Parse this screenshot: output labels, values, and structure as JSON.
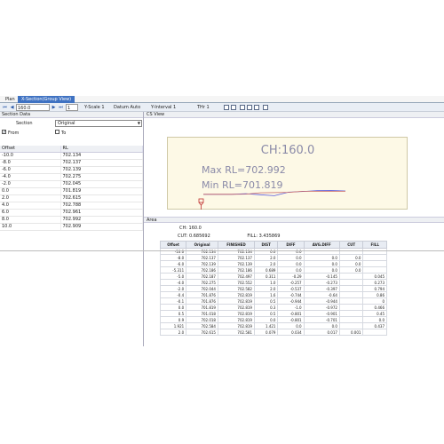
{
  "tabs": [
    {
      "label": "Plan"
    },
    {
      "label": "X-Section(Group View)"
    }
  ],
  "toolbar": {
    "ch_value": "160.0",
    "page_value": "1",
    "yscale_label": "Y-Scale",
    "yscale_value": "1",
    "datum_label": "Datum",
    "datum_value": "Auto",
    "yinterval_label": "Y-Interval",
    "yinterval_value": "1",
    "thr_label": "THr",
    "thr_value": "1"
  },
  "section_data": {
    "title": "Section Data",
    "section_label": "Section",
    "section_value": "Original",
    "from_label": "From",
    "to_label": "To",
    "columns": [
      "Offset",
      "RL"
    ],
    "rows": [
      [
        "-10.0",
        "702.134"
      ],
      [
        "-8.0",
        "702.137"
      ],
      [
        "-6.0",
        "702.139"
      ],
      [
        "-4.0",
        "702.275"
      ],
      [
        "-2.0",
        "702.045"
      ],
      [
        "0.0",
        "701.819"
      ],
      [
        "2.0",
        "702.615"
      ],
      [
        "4.0",
        "702.788"
      ],
      [
        "6.0",
        "702.961"
      ],
      [
        "8.0",
        "702.992"
      ],
      [
        "10.0",
        "702.909"
      ]
    ]
  },
  "cs_view": {
    "title": "CS View",
    "ch_text": "CH:160.0",
    "max_text": "Max RL=702.992",
    "min_text": "Min  RL=701.819"
  },
  "chart_data": {
    "type": "line",
    "title": "CH:160.0",
    "xlabel": "",
    "ylabel": "",
    "x": [
      -10.0,
      -8.0,
      -6.0,
      -4.0,
      -2.0,
      0.0,
      2.0,
      4.0,
      6.0,
      8.0,
      10.0
    ],
    "series": [
      {
        "values": [
          702.134,
          702.137,
          702.139,
          702.275,
          702.045,
          701.819,
          702.615,
          702.788,
          702.961,
          702.992,
          702.909
        ],
        "color": "#5a5adc"
      },
      {
        "values": [
          702.134,
          702.137,
          702.139,
          702.186,
          702.479,
          702.521,
          702.582,
          702.819,
          702.819,
          702.819,
          702.819
        ],
        "color": "#c86464"
      }
    ],
    "colors": {
      "profile": "#5a5adc",
      "design": "#c86464",
      "background": "#fdf9e6"
    }
  },
  "area": {
    "title": "Area",
    "ch_label": "CH:",
    "ch_value": "160.0",
    "cut_label": "CUT:",
    "cut_value": "0.685692",
    "fill_label": "FILL:",
    "fill_value": "3.435869",
    "columns": [
      "Offset",
      "Original",
      "FINISHED",
      "DIST",
      "DIFF",
      "AVG.DIFF",
      "CUT",
      "FILL"
    ],
    "rows": [
      [
        "-10.0",
        "702.134",
        "702.134",
        "0.0",
        "0.0",
        "",
        "",
        ""
      ],
      [
        "-8.0",
        "702.137",
        "702.137",
        "2.0",
        "0.0",
        "0.0",
        "0.0",
        ""
      ],
      [
        "-6.0",
        "702.139",
        "702.139",
        "2.0",
        "0.0",
        "0.0",
        "0.0",
        ""
      ],
      [
        "-5.311",
        "702.186",
        "702.186",
        "0.689",
        "0.0",
        "0.0",
        "0.0",
        ""
      ],
      [
        "-5.0",
        "702.187",
        "702.497",
        "0.311",
        "-0.29",
        "-0.145",
        "",
        "0.045"
      ],
      [
        "-4.0",
        "702.275",
        "702.552",
        "1.0",
        "-0.257",
        "-0.273",
        "",
        "0.273"
      ],
      [
        "-2.0",
        "702.044",
        "702.582",
        "2.0",
        "-0.537",
        "-0.397",
        "",
        "0.794"
      ],
      [
        "-0.4",
        "701.876",
        "702.819",
        "1.6",
        "-0.744",
        "-0.64",
        "",
        "0.86"
      ],
      [
        "-0.1",
        "701.876",
        "702.819",
        "0.5",
        "-0.944",
        "-0.944",
        "",
        "0"
      ],
      [
        "0.0",
        "701.819",
        "702.819",
        "0.3",
        "-1.0",
        "-0.972",
        "",
        "0.466"
      ],
      [
        "0.5",
        "701.018",
        "702.819",
        "0.5",
        "-0.801",
        "-0.901",
        "",
        "0.45"
      ],
      [
        "0.9",
        "702.018",
        "702.819",
        "0.0",
        "-0.801",
        "-0.701",
        "",
        "0.0"
      ],
      [
        "1.921",
        "702.584",
        "702.819",
        "1.421",
        "0.0",
        "0.0",
        "",
        "0.437"
      ],
      [
        "2.0",
        "702.615",
        "702.581",
        "0.079",
        "0.034",
        "0.017",
        "0.001",
        ""
      ]
    ]
  }
}
